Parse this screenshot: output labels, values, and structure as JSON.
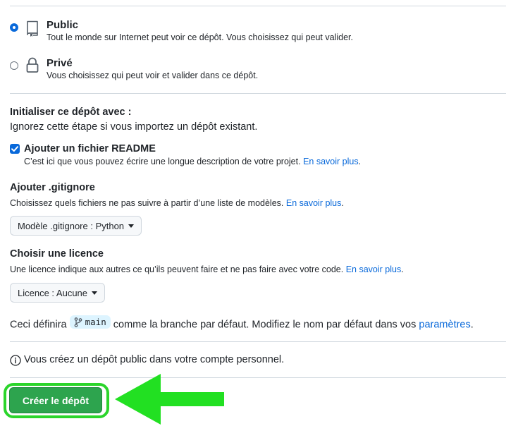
{
  "visibility": {
    "public": {
      "label": "Public",
      "description": "Tout le monde sur Internet peut voir ce dépôt. Vous choisissez qui peut valider.",
      "selected": true,
      "icon": "repo-icon"
    },
    "private": {
      "label": "Privé",
      "description": "Vous choisissez qui peut voir et valider dans ce dépôt.",
      "selected": false,
      "icon": "lock-icon"
    }
  },
  "init": {
    "heading": "Initialiser ce dépôt avec :",
    "subheading": "Ignorez cette étape si vous importez un dépôt existant.",
    "readme": {
      "label": "Ajouter un fichier README",
      "checked": true,
      "description": "C’est ici que vous pouvez écrire une longue description de votre projet.",
      "link": "En savoir plus"
    },
    "gitignore": {
      "heading": "Ajouter .gitignore",
      "description": "Choisissez quels fichiers ne pas suivre à partir d’une liste de modèles.",
      "link": "En savoir plus",
      "select_label": "Modèle .gitignore : Python"
    },
    "license": {
      "heading": "Choisir une licence",
      "description": "Une licence indique aux autres ce qu’ils peuvent faire et ne pas faire avec votre code.",
      "link": "En savoir plus",
      "select_label": "Licence : Aucune"
    }
  },
  "branch_note": {
    "prefix": "Ceci définira",
    "branch": "main",
    "middle": "comme la branche par défaut. Modifiez le nom par défaut dans vos",
    "link": "paramètres",
    "suffix": "."
  },
  "info_note": "Vous créez un dépôt public dans votre compte personnel.",
  "create_button": "Créer le dépôt",
  "colors": {
    "accent": "#0969da",
    "create_button": "#2da44e",
    "highlight": "#2bd52b"
  }
}
